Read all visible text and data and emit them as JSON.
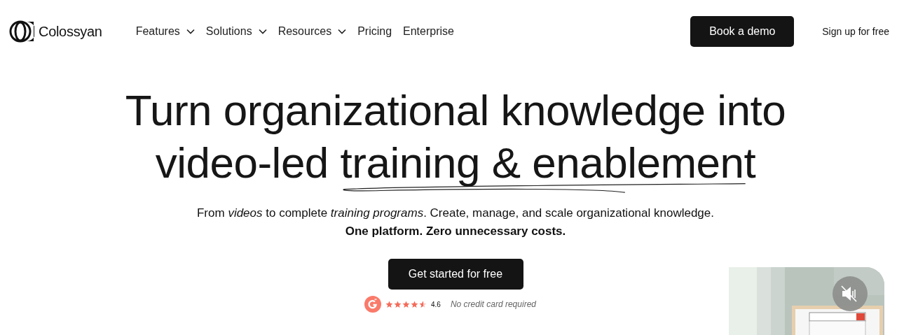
{
  "nav": {
    "brand": "Colossyan",
    "items": [
      {
        "label": "Features",
        "dropdown": true
      },
      {
        "label": "Solutions",
        "dropdown": true
      },
      {
        "label": "Resources",
        "dropdown": true
      },
      {
        "label": "Pricing",
        "dropdown": false
      },
      {
        "label": "Enterprise",
        "dropdown": false
      }
    ],
    "demo_button": "Book a demo",
    "signup_link": "Sign up for free"
  },
  "hero": {
    "headline": {
      "lead": "Turn organizational knowledge into video-led ",
      "highlight": "training & enablement"
    },
    "subtitle": "From *videos* to complete *training programs*. Create, manage, and scale organizational knowledge.",
    "tagline": "One platform. Zero unnecessary costs.",
    "cta": "Get started for free",
    "rating": {
      "stars": 4.6,
      "score": "4.6"
    },
    "note": "No credit card required"
  },
  "video": {
    "kind": "picture",
    "muted": true
  }
}
